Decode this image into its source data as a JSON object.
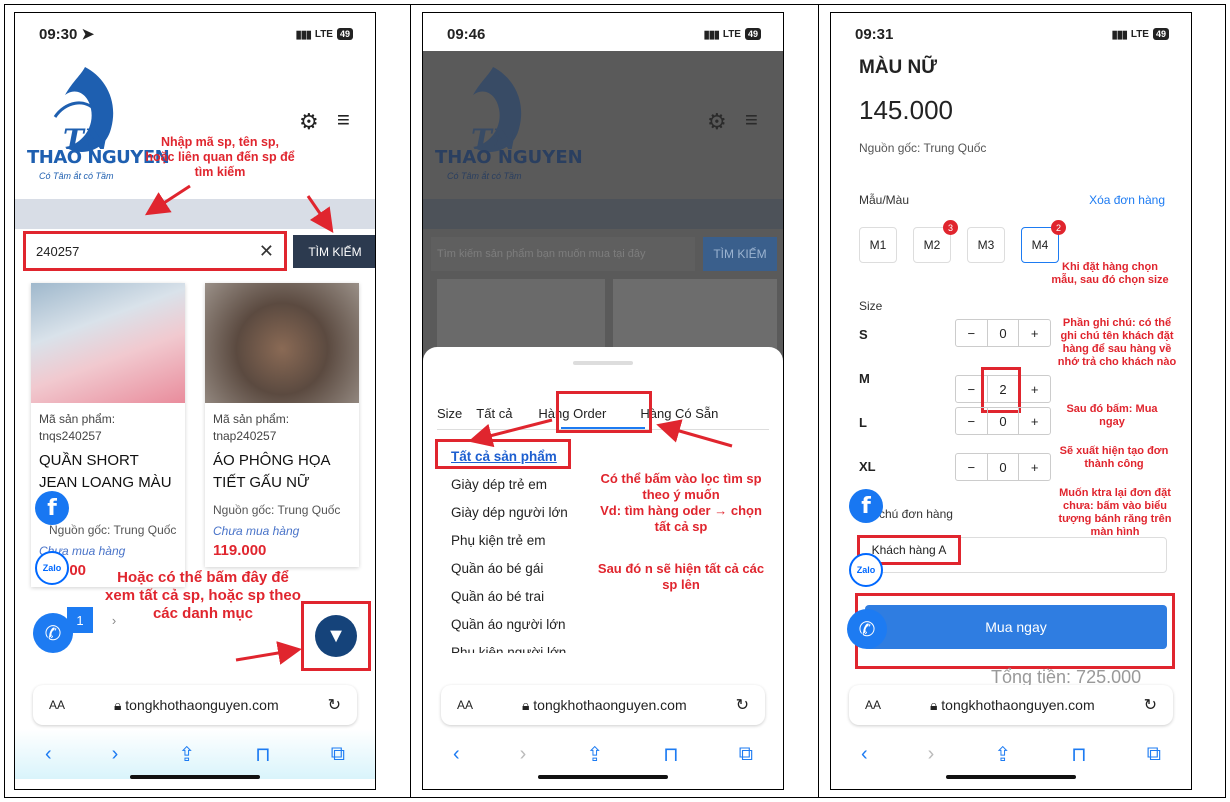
{
  "colors": {
    "accent": "#e0252e",
    "blue": "#1d7bf2",
    "navy": "#2c3a4f"
  },
  "phone1": {
    "time": "09:30",
    "status": "LTE",
    "battery": "49",
    "brand": "THAO NGUYEN",
    "brand_sub": "Có Tâm ắt có Tầm",
    "search_value": "240257",
    "search_button": "TÌM KIẾM",
    "annotation_search": "Nhập mã sp, tên sp, hoặc liên quan đến sp để tìm kiếm",
    "annotation_filter": "Hoặc có thể bấm đây để xem tất cả sp, hoặc sp theo các danh mục",
    "pager_current": "1",
    "pager_next": "›",
    "products": [
      {
        "code_label": "Mã sản phẩm:",
        "code": "tnqs240257",
        "name": "QUẦN SHORT JEAN LOANG MÀU",
        "origin": "Nguồn gốc: Trung Quốc",
        "status": "Chưa mua hàng",
        "price": "000"
      },
      {
        "code_label": "Mã sản phẩm:",
        "code": "tnap240257",
        "name": "ÁO PHÔNG HỌA TIẾT GẤU NỮ",
        "origin": "Nguồn gốc: Trung Quốc",
        "status": "Chưa mua hàng",
        "price": "119.000"
      }
    ]
  },
  "phone2": {
    "time": "09:46",
    "status": "LTE",
    "battery": "49",
    "brand": "THAO NGUYEN",
    "brand_sub": "Có Tâm ắt có Tầm",
    "search_placeholder": "Tìm kiếm sản phẩm bạn muốn mua tại đây",
    "search_button": "TÌM KIẾM",
    "tabs": [
      "Size",
      "Tất cả",
      "Hàng Order",
      "Hàng Có Sẵn"
    ],
    "categories": [
      "Tất cả sản phẩm",
      "Giày dép trẻ em",
      "Giày dép người lớn",
      "Phụ kiện trẻ em",
      "Quần áo bé gái",
      "Quần áo bé trai",
      "Quần áo người lớn",
      "Phụ kiện người lớn"
    ],
    "annotation_1": "Có thể bấm vào lọc tìm sp theo ý muốn",
    "annotation_2": "Vd: tìm hàng oder → chọn tất cả sp",
    "annotation_3": "Sau đó n sẽ hiện tất cả các sp lên"
  },
  "phone3": {
    "time": "09:31",
    "status": "LTE",
    "battery": "49",
    "title": "MÀU NỮ",
    "price": "145.000",
    "origin": "Nguồn gốc: Trung Quốc",
    "color_label": "Mẫu/Màu",
    "clear_order": "Xóa đơn hàng",
    "models": [
      {
        "label": "M1",
        "badge": ""
      },
      {
        "label": "M2",
        "badge": "3"
      },
      {
        "label": "M3",
        "badge": ""
      },
      {
        "label": "M4",
        "badge": "2"
      }
    ],
    "size_label": "Size",
    "sizes": [
      {
        "label": "S",
        "qty": "0"
      },
      {
        "label": "M",
        "qty": "2"
      },
      {
        "label": "L",
        "qty": "0"
      },
      {
        "label": "XL",
        "qty": "0"
      }
    ],
    "minus": "−",
    "plus": "+",
    "note_label": "chú đơn hàng",
    "note_value": "Khách hàng A",
    "buy_button": "Mua ngay",
    "total_partial": "Tổng tiền: 725.000",
    "annotations": [
      "Khi đặt hàng chọn mẫu, sau đó chọn size",
      "Phần ghi chú: có thể ghi chú tên khách đặt hàng để sau hàng về nhớ trả cho khách nào",
      "Sau đó bấm: Mua ngay",
      "Sẽ xuất hiện tạo đơn thành công",
      "Muốn ktra lại đơn đặt chưa: bấm vào biểu tượng bánh răng trên màn hình"
    ]
  },
  "browser": {
    "aa": "AA",
    "url": "tongkhothaonguyen.com",
    "reload": "↻"
  }
}
